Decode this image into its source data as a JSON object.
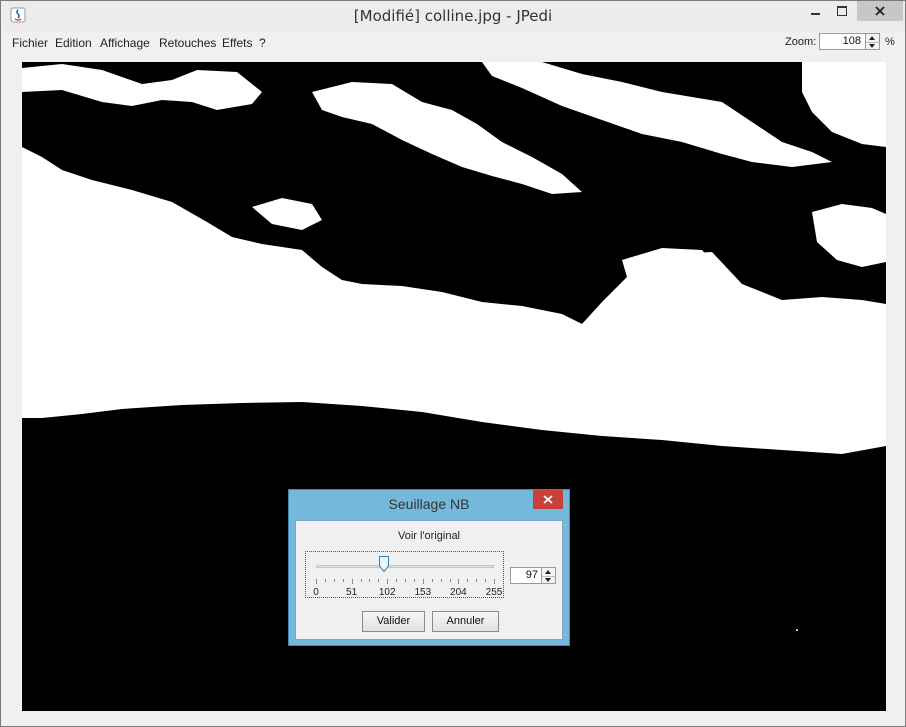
{
  "window": {
    "title": "[Modifié] colline.jpg  -  JPedi"
  },
  "menu": {
    "items": [
      "Fichier",
      "Edition",
      "Affichage",
      "Retouches",
      "Effets",
      "?"
    ]
  },
  "zoom": {
    "label": "Zoom:",
    "value": "108",
    "unit": "%"
  },
  "dialog": {
    "title": "Seuillage NB",
    "voir_label": "Voir l'original",
    "slider": {
      "min": 0,
      "max": 255,
      "value": 97,
      "tick_labels": [
        "0",
        "51",
        "102",
        "153",
        "204",
        "255"
      ]
    },
    "value_field": "97",
    "valider_label": "Valider",
    "annuler_label": "Annuler"
  },
  "colors": {
    "dialog_frame": "#74b9dc",
    "close_button": "#c9403a",
    "image_dark": "#000000",
    "image_light": "#ffffff"
  }
}
